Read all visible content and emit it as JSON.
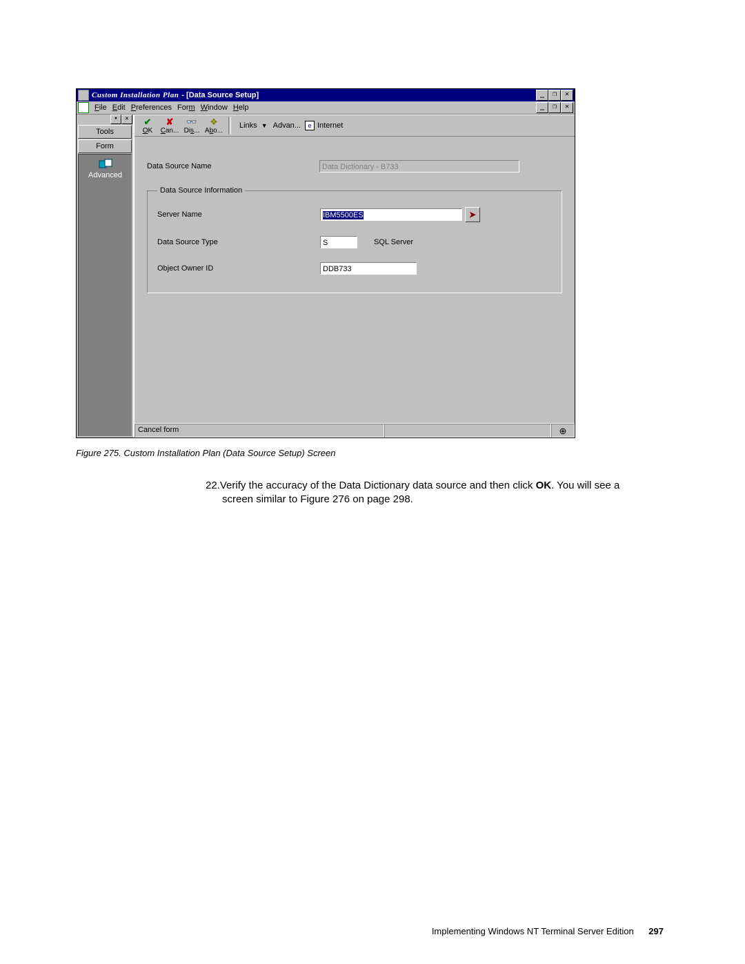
{
  "window": {
    "app_title": "Custom Installation Plan",
    "subtitle": "  - [Data Source Setup]",
    "outer_controls": {
      "min": "_",
      "max": "❐",
      "close": "✕"
    },
    "mdi_controls": {
      "min": "_",
      "restore": "❐",
      "close": "✕"
    }
  },
  "menubar": {
    "file": "File",
    "edit": "Edit",
    "preferences": "Preferences",
    "form": "Form",
    "window": "Window",
    "help": "Help"
  },
  "palette": {
    "tools": "Tools",
    "form": "Form",
    "advanced": "Advanced"
  },
  "toolbar": {
    "ok": "OK",
    "cancel": "Can...",
    "display": "Dis...",
    "about": "Abo...",
    "links": "Links",
    "advan": "Advan...",
    "internet": "Internet"
  },
  "form": {
    "data_source_name_label": "Data Source Name",
    "data_source_name_value": "Data Dictionary - B733",
    "group_legend": "Data Source Information",
    "server_name_label": "Server Name",
    "server_name_value": "IBM5500ES",
    "data_source_type_label": "Data Source Type",
    "data_source_type_code": "S",
    "data_source_type_desc": "SQL Server",
    "object_owner_label": "Object Owner ID",
    "object_owner_value": "DDB733"
  },
  "statusbar": {
    "message": "Cancel form",
    "grip_icon": "⊕"
  },
  "caption": "Figure 275.  Custom Installation Plan (Data Source Setup) Screen",
  "body_step_num": "22.",
  "body_step_a": "Verify the accuracy of the Data Dictionary data source and then click ",
  "body_step_bold": "OK",
  "body_step_b": ". You will see a screen similar to Figure 276 on page 298.",
  "footer_text": "Implementing Windows NT Terminal Server Edition",
  "footer_page": "297"
}
